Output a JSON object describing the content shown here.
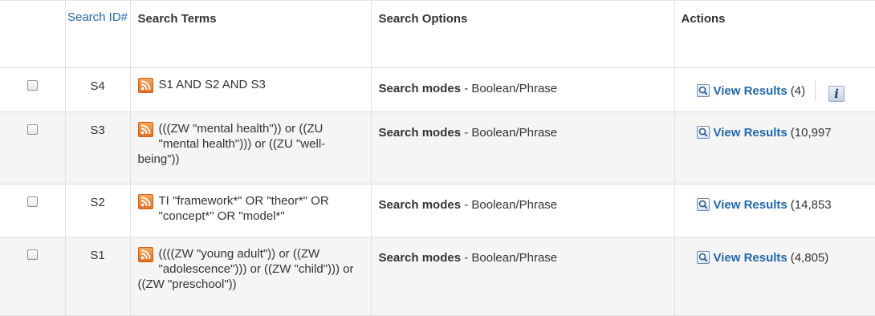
{
  "table": {
    "headers": {
      "search_id": "Search ID#",
      "search_terms": "Search Terms",
      "search_options": "Search Options",
      "actions": "Actions"
    },
    "rows": [
      {
        "id": "S4",
        "terms": "S1 AND S2 AND S3",
        "options_label": "Search modes",
        "options_sep": " - ",
        "options_value": "Boolean/Phrase",
        "action_label": "View Results",
        "count": "(4)"
      },
      {
        "id": "S3",
        "terms": "(((ZW \"mental health\")) or ((ZU \"mental health\"))) or ((ZU \"well-being\"))",
        "options_label": "Search modes",
        "options_sep": " - ",
        "options_value": "Boolean/Phrase",
        "action_label": "View Results",
        "count": "(10,997"
      },
      {
        "id": "S2",
        "terms": "TI \"framework*\" OR \"theor*\" OR \"concept*\" OR \"model*\"",
        "options_label": "Search modes",
        "options_sep": " - ",
        "options_value": "Boolean/Phrase",
        "action_label": "View Results",
        "count": "(14,853"
      },
      {
        "id": "S1",
        "terms": "((((ZW \"young adult\")) or ((ZW \"adolescence\"))) or ((ZW \"child\"))) or ((ZW \"preschool\"))",
        "options_label": "Search modes",
        "options_sep": " - ",
        "options_value": "Boolean/Phrase",
        "action_label": "View Results",
        "count": "(4,805)"
      }
    ]
  },
  "icons": {
    "rss": "rss-icon",
    "search": "search-icon",
    "info": "info-icon"
  },
  "colors": {
    "link": "#1f67b0",
    "rss": "#e86d1f",
    "row_alt": "#f5f5f5"
  }
}
